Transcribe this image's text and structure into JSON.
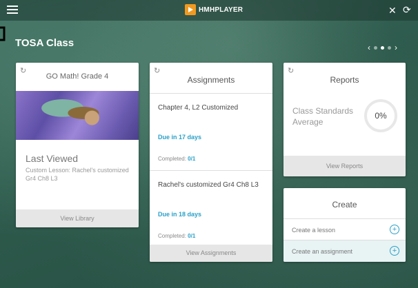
{
  "header": {
    "logo_text": "HMHPLAYER"
  },
  "class_title": "TOSA Class",
  "pager": {
    "prev": "‹",
    "next": "›",
    "dots": 3,
    "active_dot": 2
  },
  "library": {
    "title": "GO Math! Grade 4",
    "last_viewed_heading": "Last Viewed",
    "last_viewed_desc": "Custom Lesson: Rachel's customized Gr4 Ch8 L3",
    "footer": "View Library"
  },
  "assignments": {
    "title": "Assignments",
    "items": [
      {
        "title": "Chapter 4, L2 Customized",
        "due": "Due in 17 days",
        "completed_label": "Completed:",
        "completed_value": "0/1"
      },
      {
        "title": "Rachel's customized Gr4 Ch8 L3",
        "due": "Due in 18 days",
        "completed_label": "Completed:",
        "completed_value": "0/1"
      }
    ],
    "footer": "View Assignments"
  },
  "reports": {
    "title": "Reports",
    "label": "Class Standards Average",
    "value": "0%",
    "footer": "View Reports"
  },
  "create": {
    "title": "Create",
    "items": [
      {
        "label": "Create a lesson"
      },
      {
        "label": "Create an assignment"
      }
    ]
  },
  "icons": {
    "menu": "hamburger-icon",
    "tools": "tools-icon",
    "refresh": "refresh-icon",
    "plus": "plus-circle-icon"
  },
  "colors": {
    "accent": "#2aa0c8",
    "logo_orange": "#f29a1f",
    "background": "#2f5d4f"
  }
}
